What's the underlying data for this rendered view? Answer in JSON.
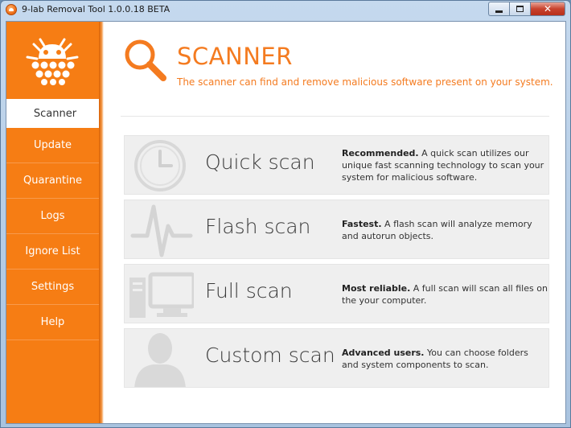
{
  "window": {
    "title": "9-lab Removal Tool 1.0.0.18 BETA",
    "close_glyph": "✕"
  },
  "colors": {
    "accent": "#f67d14",
    "title_orange": "#f47b20",
    "card_bg": "#efefef"
  },
  "sidebar": {
    "logo_icon": "bug-logo-icon",
    "items": [
      {
        "label": "Scanner",
        "active": true
      },
      {
        "label": "Update"
      },
      {
        "label": "Quarantine"
      },
      {
        "label": "Logs"
      },
      {
        "label": "Ignore List"
      },
      {
        "label": "Settings"
      },
      {
        "label": "Help"
      }
    ]
  },
  "header": {
    "icon": "magnifier-icon",
    "title": "SCANNER",
    "subtitle": "The scanner can find and remove malicious software present on your system."
  },
  "scans": [
    {
      "name": "Quick scan",
      "icon": "clock-icon",
      "lead": "Recommended.",
      "desc": " A quick scan utilizes our unique fast scanning technology to scan your system for malicious software."
    },
    {
      "name": "Flash scan",
      "icon": "pulse-icon",
      "lead": "Fastest.",
      "desc": " A flash scan will analyze memory and autorun objects."
    },
    {
      "name": "Full scan",
      "icon": "computer-icon",
      "lead": "Most reliable.",
      "desc": " A full scan will scan all files on the your computer."
    },
    {
      "name": "Custom scan",
      "icon": "user-icon",
      "lead": "Advanced users.",
      "desc": " You can choose folders and system components to scan."
    }
  ]
}
